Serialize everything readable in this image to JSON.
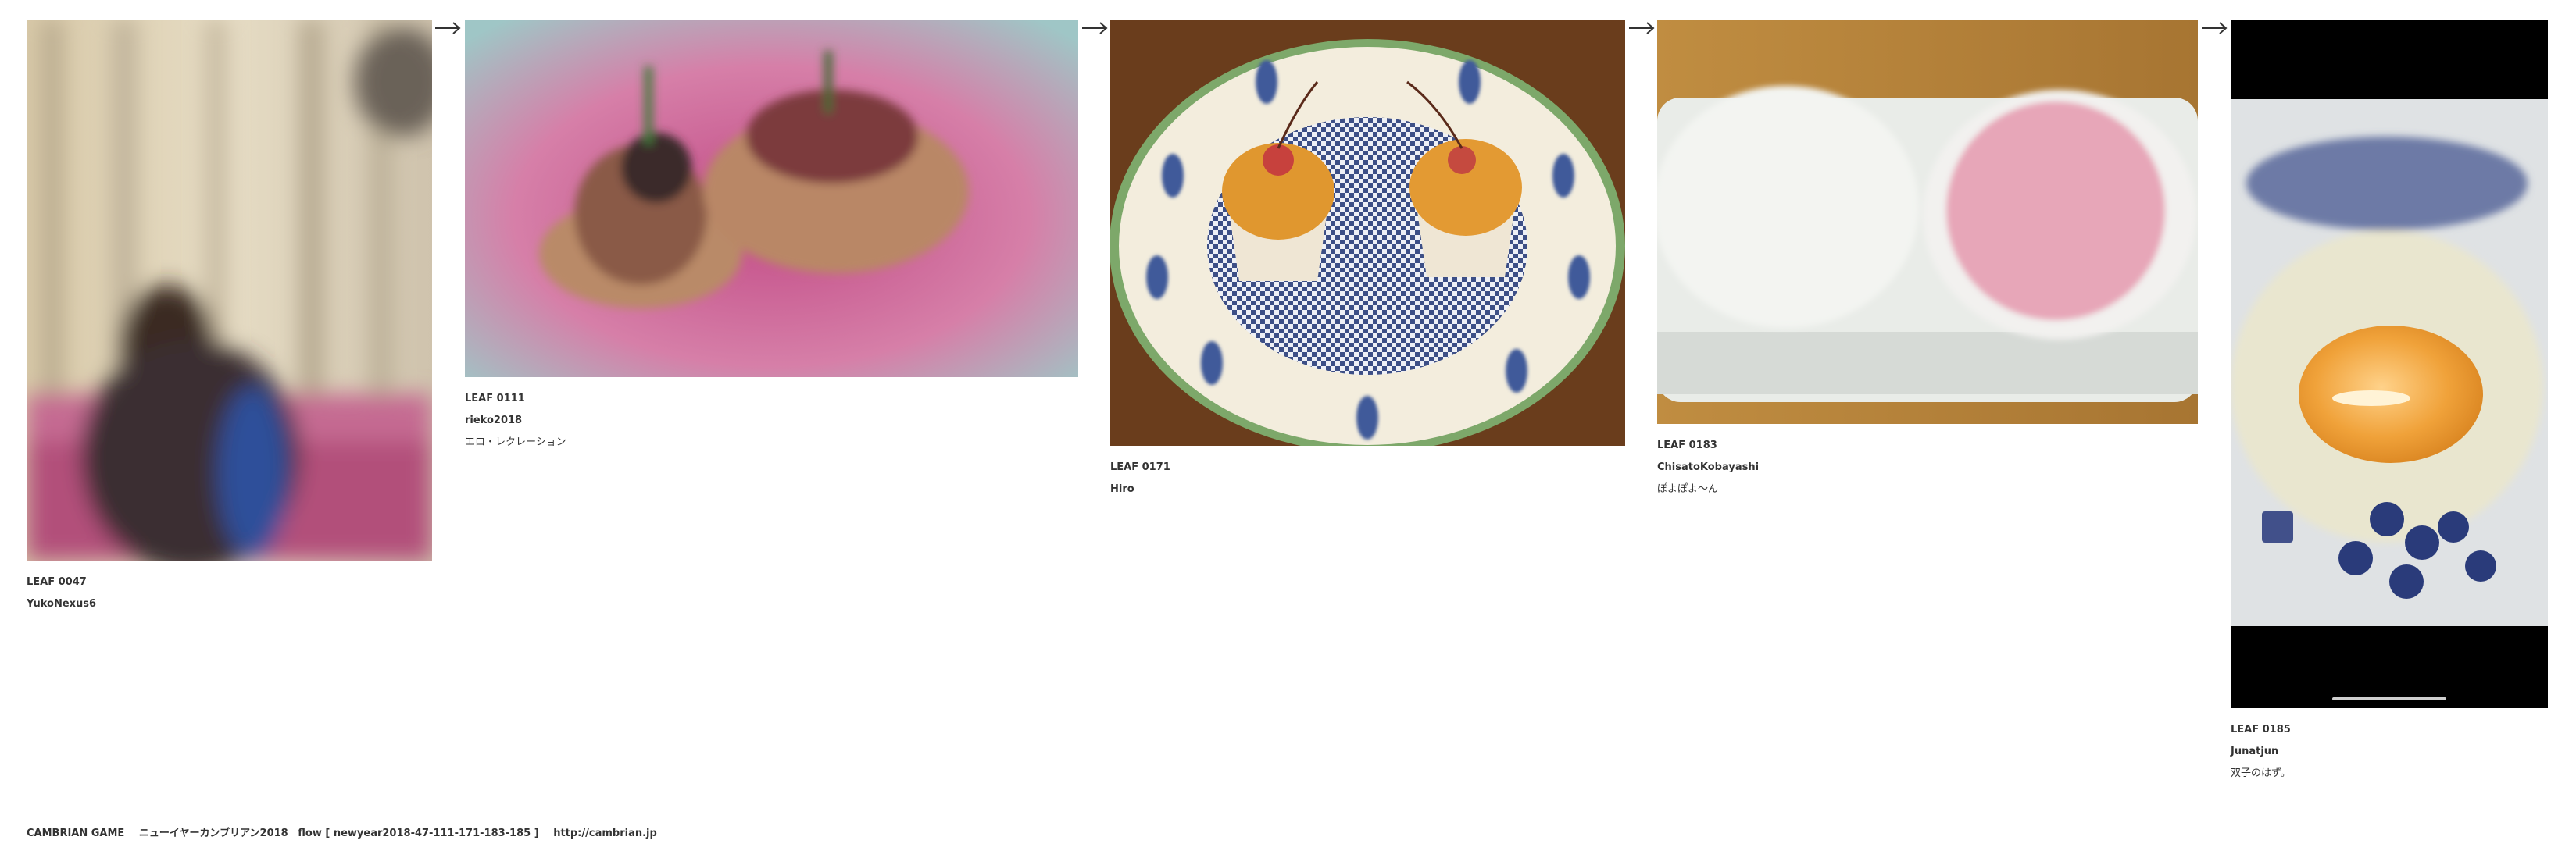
{
  "leaves": [
    {
      "id": "LEAF 0047",
      "author": "YukoNexus6",
      "title": "",
      "image": "blurred-person-photo"
    },
    {
      "id": "LEAF 0111",
      "author": "rieko2018",
      "title": "エロ・レクレーション",
      "image": "beet-roots-photo"
    },
    {
      "id": "LEAF 0171",
      "author": "Hiro",
      "title": "",
      "image": "cupcakes-on-plate-photo"
    },
    {
      "id": "LEAF 0183",
      "author": "ChisatoKobayashi",
      "title": "ぽよぽよ〜ん",
      "image": "daifuku-mochi-photo"
    },
    {
      "id": "LEAF 0185",
      "author": "Junatjun",
      "title": "双子のはず。",
      "image": "egg-yolk-in-bowl-photo"
    }
  ],
  "arrow_icon": "right-arrow-icon",
  "footer": {
    "site": "CAMBRIAN GAME",
    "flow_title": "ニューイヤーカンブリアン2018",
    "flow": "flow [ newyear2018-47-111-171-183-185 ]",
    "url": "http://cambrian.jp"
  }
}
